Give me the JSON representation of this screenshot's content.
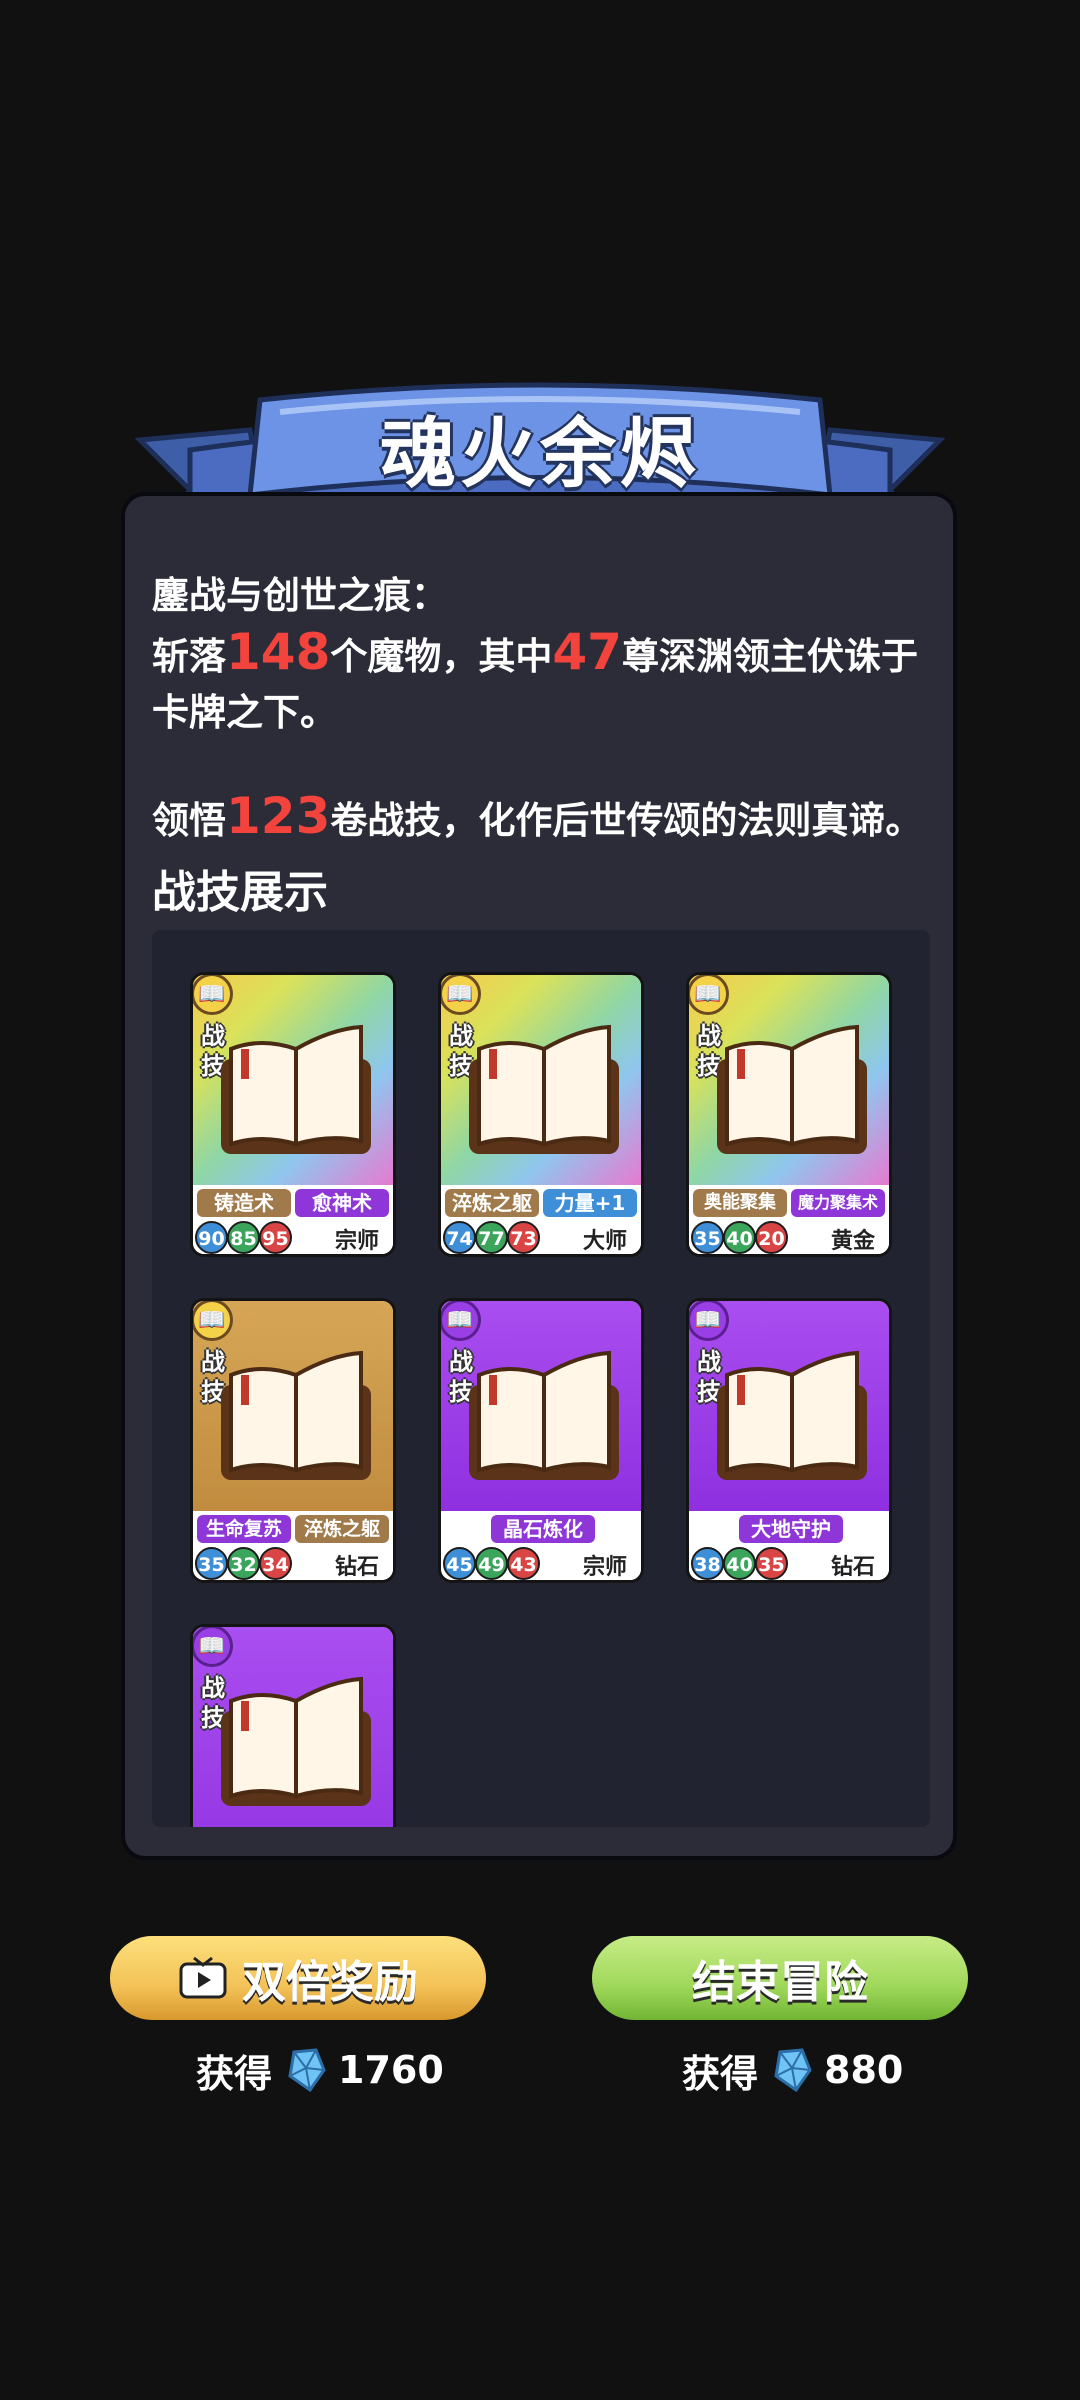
{
  "title": "魂火余烬",
  "story": {
    "line1": "鏖战与创世之痕：",
    "kill_prefix": "斩落",
    "monsters": "148",
    "kill_mid": "个魔物，其中",
    "lords": "47",
    "kill_suffix": "尊深渊领主伏诛于",
    "kill_line2": "卡牌之下。",
    "learn_prefix": "领悟",
    "skills": "123",
    "learn_suffix": "卷战技，化作后世传颂的法则真谛。"
  },
  "section_title": "战技展示",
  "card_label": "战技",
  "cards": [
    {
      "tags": [
        "铸造术",
        "愈神术"
      ],
      "stats": [
        "90",
        "85",
        "95"
      ],
      "rank": "宗师"
    },
    {
      "tags": [
        "淬炼之躯",
        "力量+1"
      ],
      "stats": [
        "74",
        "77",
        "73"
      ],
      "rank": "大师"
    },
    {
      "tags": [
        "奥能聚集",
        "魔力聚集术"
      ],
      "stats": [
        "35",
        "40",
        "20"
      ],
      "rank": "黄金"
    },
    {
      "tags": [
        "生命复苏",
        "淬炼之躯"
      ],
      "stats": [
        "35",
        "32",
        "34"
      ],
      "rank": "钻石"
    },
    {
      "tags": [
        "晶石炼化"
      ],
      "stats": [
        "45",
        "49",
        "43"
      ],
      "rank": "宗师"
    },
    {
      "tags": [
        "大地守护"
      ],
      "stats": [
        "38",
        "40",
        "35"
      ],
      "rank": "钻石"
    }
  ],
  "buttons": {
    "double": "双倍奖励",
    "end": "结束冒险"
  },
  "rewards": {
    "label": "获得",
    "double_amount": "1760",
    "end_amount": "880"
  },
  "icons": {
    "badge": "book-icon",
    "tv": "tv-icon",
    "gem": "gem-icon"
  },
  "colors": {
    "accent_number": "#f2433d",
    "banner_blue": "#5b7fd0",
    "double_button": "#f3c257",
    "end_button": "#9fd85a"
  }
}
